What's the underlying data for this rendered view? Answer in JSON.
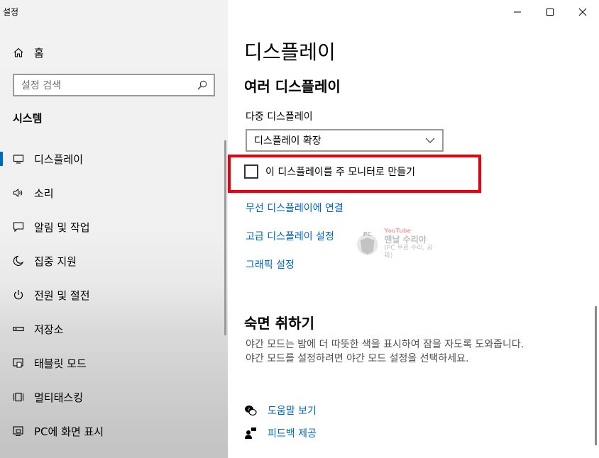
{
  "window": {
    "title": "설정"
  },
  "sidebar": {
    "home_label": "홈",
    "search_placeholder": "설정 검색",
    "section_title": "시스템",
    "items": [
      {
        "label": "디스플레이",
        "icon": "monitor-icon",
        "selected": true
      },
      {
        "label": "소리",
        "icon": "speaker-icon"
      },
      {
        "label": "알림 및 작업",
        "icon": "notification-icon"
      },
      {
        "label": "집중 지원",
        "icon": "moon-icon"
      },
      {
        "label": "전원 및 절전",
        "icon": "power-icon"
      },
      {
        "label": "저장소",
        "icon": "storage-icon"
      },
      {
        "label": "태블릿 모드",
        "icon": "tablet-icon"
      },
      {
        "label": "멀티태스킹",
        "icon": "multitasking-icon"
      },
      {
        "label": "PC에 화면 표시",
        "icon": "project-icon"
      }
    ]
  },
  "main": {
    "page_title": "디스플레이",
    "multi_display": {
      "heading": "여러 디스플레이",
      "field_label": "다중 디스플레이",
      "dropdown_value": "디스플레이 확장",
      "checkbox_label": "이 디스플레이를 주 모니터로 만들기",
      "checkbox_checked": false
    },
    "links": {
      "wireless": "무선 디스플레이에 연결",
      "advanced": "고급 디스플레이 설정",
      "graphics": "그래픽 설정"
    },
    "watermark": {
      "badge": "PC",
      "youtube": "YouTube",
      "name": "맨날 수리야",
      "tagline": "(PC 무료 수리, 공짜)"
    },
    "sleep": {
      "heading": "숙면 취하기",
      "line1": "야간 모드는 밤에 더 따뜻한 색을 표시하여 잠을 자도록 도와줍니다.",
      "line2": "야간 모드를 설정하려면 야간 모드 설정을 선택하세요."
    },
    "help": {
      "get_help": "도움말 보기",
      "feedback": "피드백 제공"
    }
  },
  "colors": {
    "accent": "#0067c0",
    "highlight_border": "#e60012"
  }
}
